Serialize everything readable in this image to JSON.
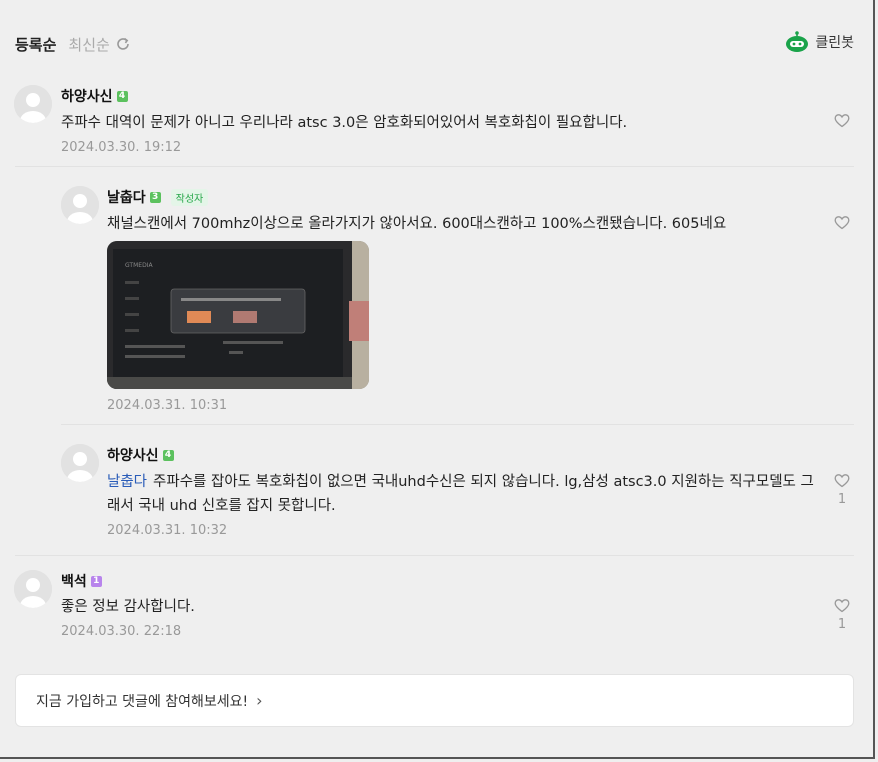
{
  "sort": {
    "registered": "등록순",
    "latest": "최신순"
  },
  "cleanbot": {
    "label": "클린봇",
    "color": "#1aa34a"
  },
  "comments": [
    {
      "author": "하양사신",
      "level": "4",
      "text": "주파수 대역이 문제가 아니고 우리나라 atsc 3.0은 암호화되어있어서 복호화칩이 필요합니다.",
      "date": "2024.03.30. 19:12",
      "likes": ""
    },
    {
      "author": "날춥다",
      "level": "3",
      "badge": "작성자",
      "text": "채널스캔에서 700mhz이상으로 올라가지가 않아서요. 600대스캔하고 100%스캔됐습니다. 605네요",
      "date": "2024.03.31. 10:31",
      "likes": ""
    },
    {
      "author": "하양사신",
      "level": "4",
      "mention": "날춥다",
      "text": "주파수를 잡아도 복호화칩이 없으면 국내uhd수신은 되지 않습니다. lg,삼성 atsc3.0 지원하는 직구모델도 그래서 국내 uhd 신호를 잡지 못합니다.",
      "date": "2024.03.31. 10:32",
      "likes": "1"
    },
    {
      "author": "백석",
      "level": "1",
      "text": "좋은 정보 감사합니다.",
      "date": "2024.03.30. 22:18",
      "likes": "1"
    }
  ],
  "join": {
    "label": "지금 가입하고 댓글에 참여해보세요!",
    "chevron": "›"
  },
  "colors": {
    "level_green": "#5cc15e",
    "level_purple": "#b884ec",
    "mention": "#2a5cb8"
  }
}
